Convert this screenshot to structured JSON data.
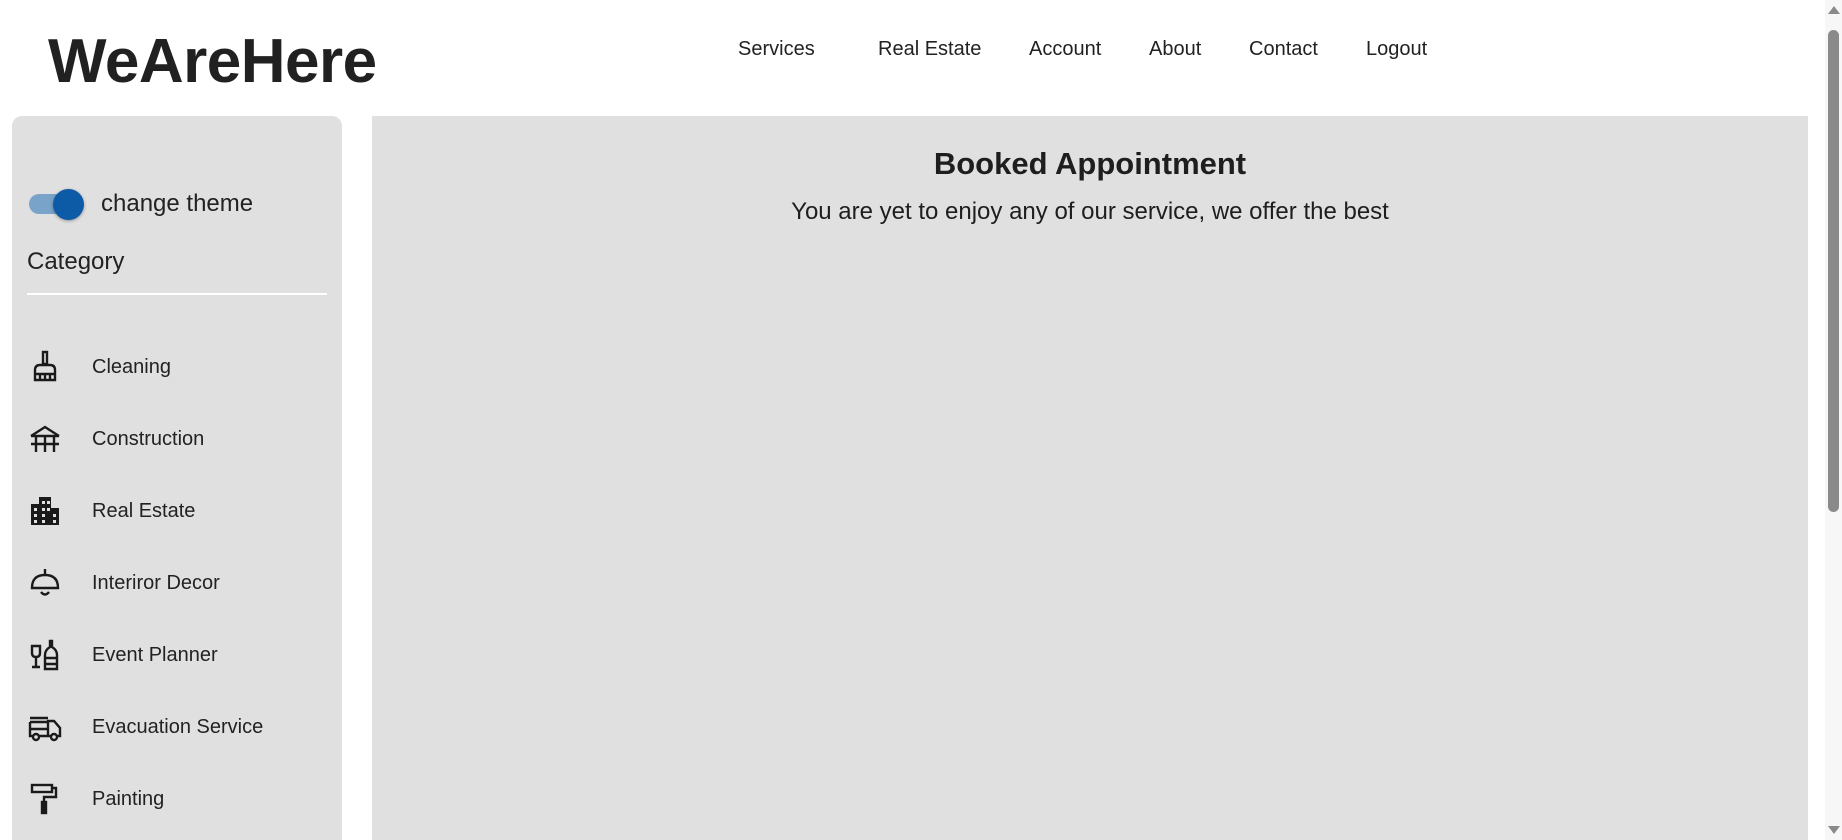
{
  "brand": {
    "name": "WeAreHere"
  },
  "nav": {
    "items": [
      {
        "label": "Services"
      },
      {
        "label": "Real Estate"
      },
      {
        "label": "Account"
      },
      {
        "label": "About"
      },
      {
        "label": "Contact"
      },
      {
        "label": "Logout"
      }
    ]
  },
  "sidebar": {
    "theme_toggle_label": "change theme",
    "theme_toggle_on": true,
    "category_title": "Category",
    "categories": [
      {
        "label": "Cleaning",
        "icon": "broom-icon"
      },
      {
        "label": "Construction",
        "icon": "construction-icon"
      },
      {
        "label": "Real Estate",
        "icon": "building-icon"
      },
      {
        "label": "Interiror Decor",
        "icon": "ceiling-lamp-icon"
      },
      {
        "label": "Event Planner",
        "icon": "wine-bottle-glass-icon"
      },
      {
        "label": "Evacuation Service",
        "icon": "fire-truck-icon"
      },
      {
        "label": "Painting",
        "icon": "paint-roller-icon"
      }
    ]
  },
  "main": {
    "title": "Booked Appointment",
    "subtitle": "You are yet to enjoy any of our service, we offer the best"
  },
  "colors": {
    "panel_bg": "#e0e0e0",
    "toggle_thumb": "#0d5ba6",
    "toggle_track": "#7aa3c9"
  }
}
